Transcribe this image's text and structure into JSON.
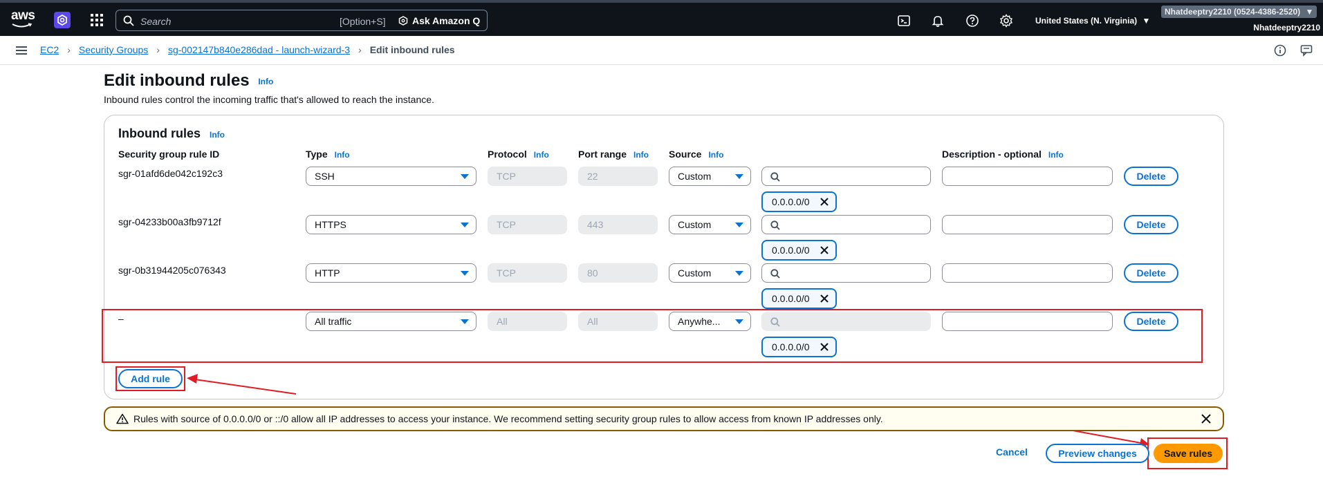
{
  "topnav": {
    "logo_text": "aws",
    "search_placeholder": "Search",
    "search_shortcut": "[Option+S]",
    "ask_q_label": "Ask Amazon Q",
    "region": "United States (N. Virginia)",
    "account_id": "Nhatdeeptry2210 (0524-4386-2520)",
    "account_name": "Nhatdeeptry2210"
  },
  "breadcrumb": {
    "items": [
      "EC2",
      "Security Groups",
      "sg-002147b840e286dad - launch-wizard-3"
    ],
    "current": "Edit inbound rules"
  },
  "page": {
    "title": "Edit inbound rules",
    "info": "Info",
    "description": "Inbound rules control the incoming traffic that's allowed to reach the instance."
  },
  "panel": {
    "title": "Inbound rules",
    "info": "Info",
    "columns": {
      "rule_id": "Security group rule ID",
      "type": "Type",
      "protocol": "Protocol",
      "port_range": "Port range",
      "source": "Source",
      "description": "Description - optional"
    },
    "rules": [
      {
        "id": "sgr-01afd6de042c192c3",
        "type": "SSH",
        "protocol": "TCP",
        "port": "22",
        "source": "Custom",
        "cidr": "0.0.0.0/0",
        "delete": "Delete"
      },
      {
        "id": "sgr-04233b00a3fb9712f",
        "type": "HTTPS",
        "protocol": "TCP",
        "port": "443",
        "source": "Custom",
        "cidr": "0.0.0.0/0",
        "delete": "Delete"
      },
      {
        "id": "sgr-0b31944205c076343",
        "type": "HTTP",
        "protocol": "TCP",
        "port": "80",
        "source": "Custom",
        "cidr": "0.0.0.0/0",
        "delete": "Delete"
      },
      {
        "id": "–",
        "type": "All traffic",
        "protocol": "All",
        "port": "All",
        "source": "Anywhe...",
        "cidr": "0.0.0.0/0",
        "delete": "Delete"
      }
    ],
    "add_rule": "Add rule"
  },
  "warning": {
    "text": "Rules with source of 0.0.0.0/0 or ::/0 allow all IP addresses to access your instance. We recommend setting security group rules to allow access from known IP addresses only."
  },
  "footer": {
    "cancel": "Cancel",
    "preview": "Preview changes",
    "save": "Save rules"
  },
  "colors": {
    "nav_bg": "#0f141a",
    "link": "#0972d3",
    "primary_button": "#ff9900",
    "annotation_red": "#e01b24",
    "warning_border": "#855900"
  }
}
